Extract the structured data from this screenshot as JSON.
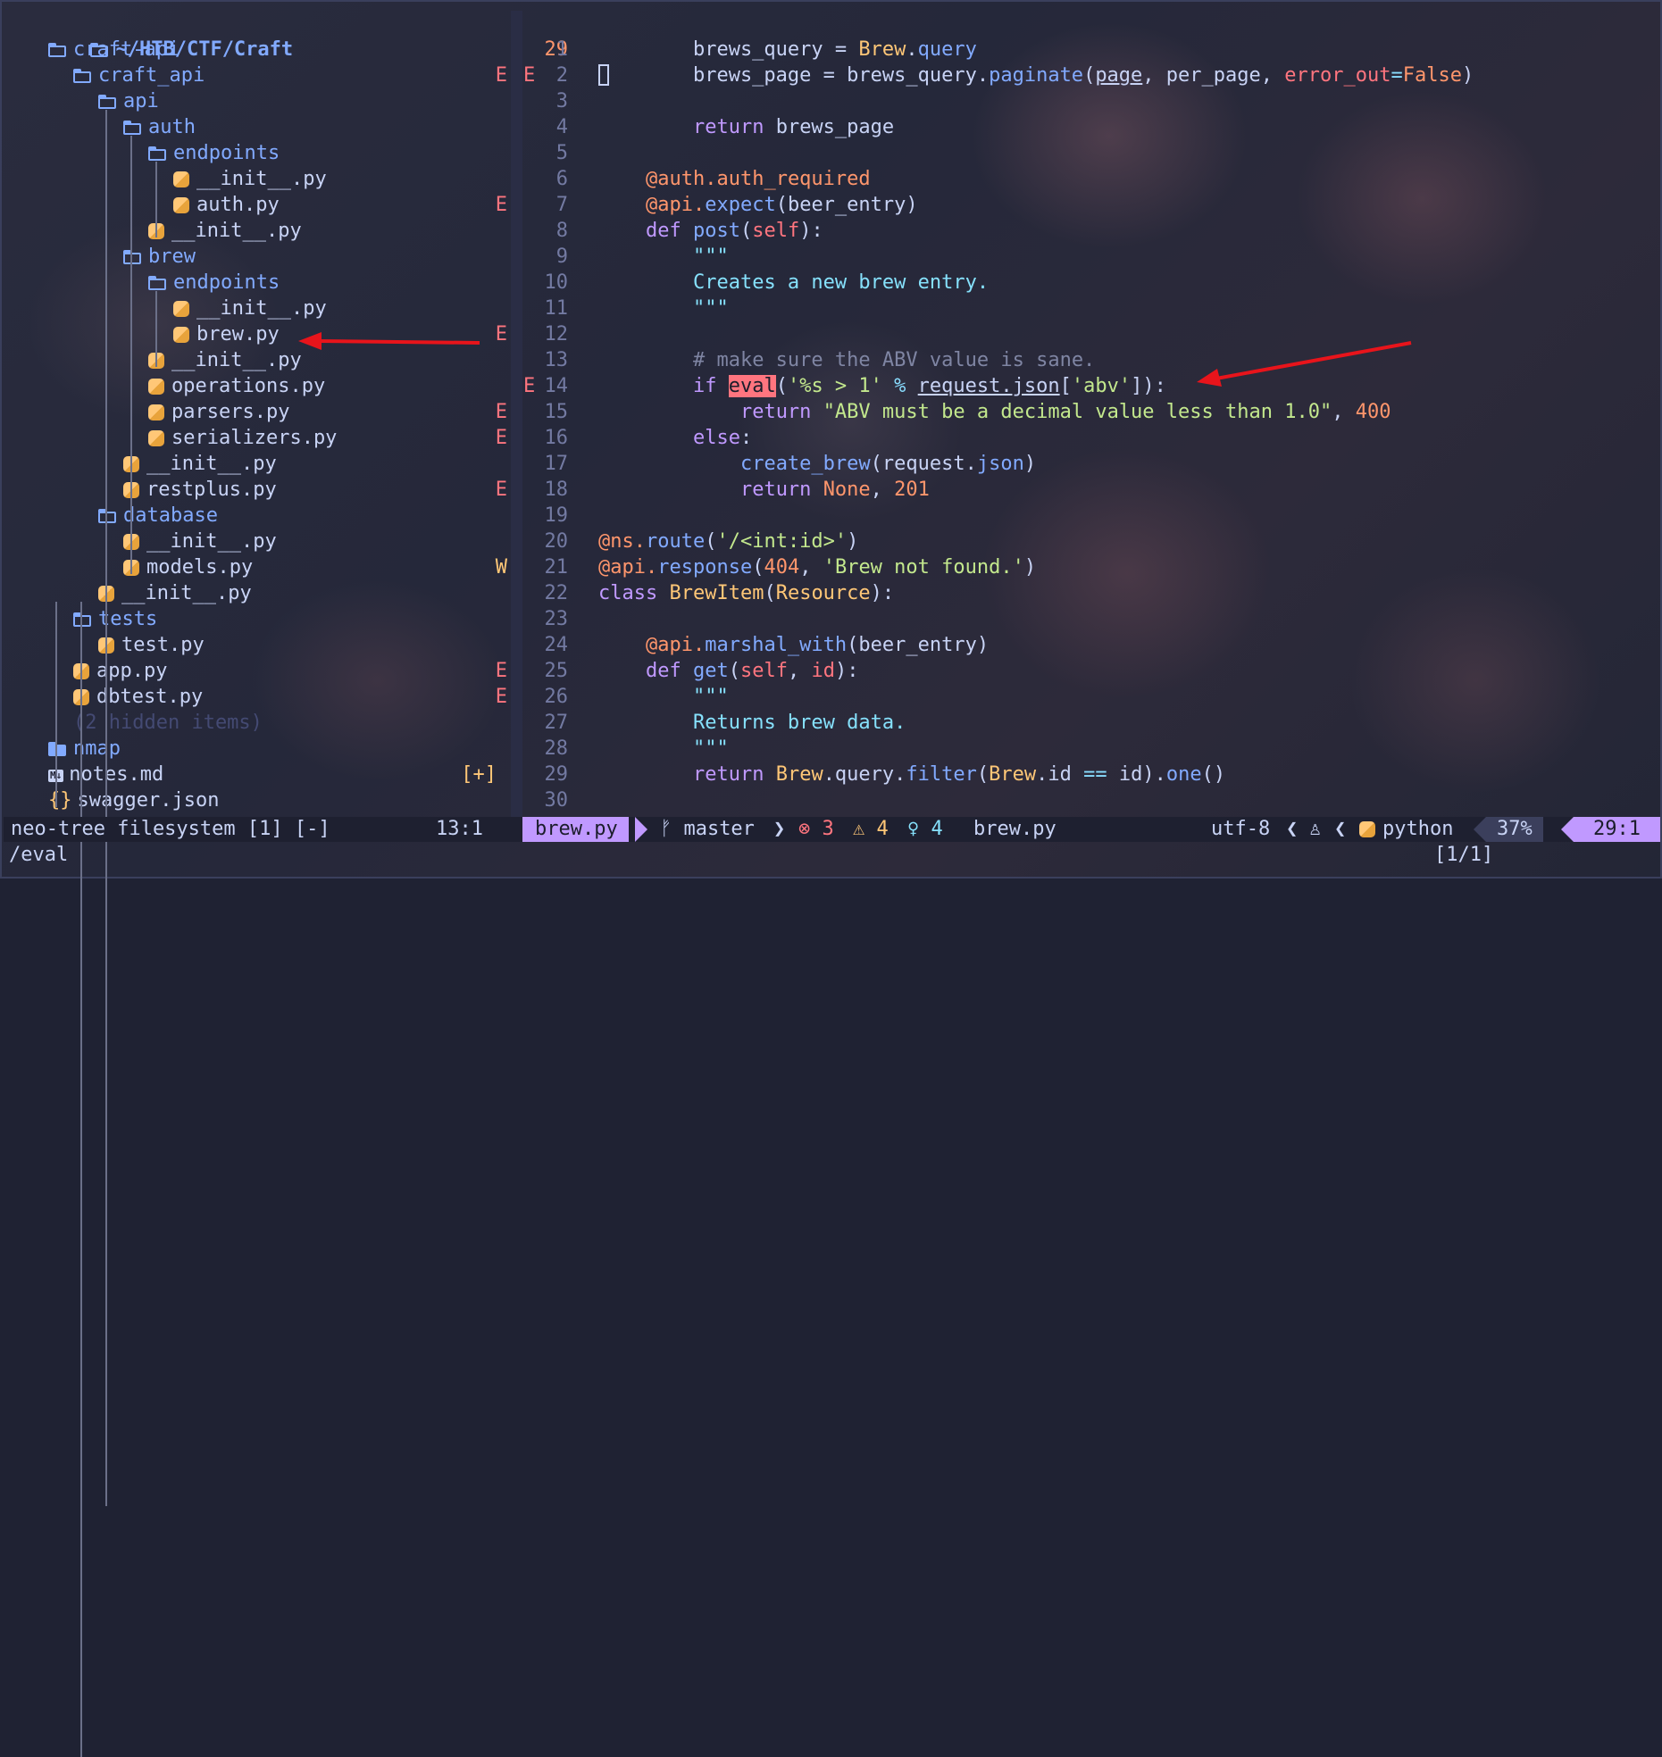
{
  "tree": {
    "root": "~/HTB/CTF/Craft",
    "items": [
      {
        "label": "craft-api",
        "kind": "dir-open",
        "indent": 1,
        "diag": ""
      },
      {
        "label": "craft_api",
        "kind": "dir-open",
        "indent": 2,
        "diag": "E"
      },
      {
        "label": "api",
        "kind": "dir-open",
        "indent": 3,
        "diag": ""
      },
      {
        "label": "auth",
        "kind": "dir-open",
        "indent": 4,
        "diag": ""
      },
      {
        "label": "endpoints",
        "kind": "dir-open",
        "indent": 5,
        "diag": ""
      },
      {
        "label": "__init__.py",
        "kind": "py",
        "indent": 6,
        "diag": ""
      },
      {
        "label": "auth.py",
        "kind": "py",
        "indent": 6,
        "diag": "E"
      },
      {
        "label": "__init__.py",
        "kind": "py",
        "indent": 5,
        "diag": ""
      },
      {
        "label": "brew",
        "kind": "dir-open",
        "indent": 4,
        "diag": ""
      },
      {
        "label": "endpoints",
        "kind": "dir-open",
        "indent": 5,
        "diag": ""
      },
      {
        "label": "__init__.py",
        "kind": "py",
        "indent": 6,
        "diag": ""
      },
      {
        "label": "brew.py",
        "kind": "py",
        "indent": 6,
        "diag": "E"
      },
      {
        "label": "__init__.py",
        "kind": "py",
        "indent": 5,
        "diag": ""
      },
      {
        "label": "operations.py",
        "kind": "py",
        "indent": 5,
        "diag": ""
      },
      {
        "label": "parsers.py",
        "kind": "py",
        "indent": 5,
        "diag": "E"
      },
      {
        "label": "serializers.py",
        "kind": "py",
        "indent": 5,
        "diag": "E"
      },
      {
        "label": "__init__.py",
        "kind": "py",
        "indent": 4,
        "diag": ""
      },
      {
        "label": "restplus.py",
        "kind": "py",
        "indent": 4,
        "diag": "E"
      },
      {
        "label": "database",
        "kind": "dir-open",
        "indent": 3,
        "diag": ""
      },
      {
        "label": "__init__.py",
        "kind": "py",
        "indent": 4,
        "diag": ""
      },
      {
        "label": "models.py",
        "kind": "py",
        "indent": 4,
        "diag": "W"
      },
      {
        "label": "__init__.py",
        "kind": "py",
        "indent": 3,
        "diag": ""
      },
      {
        "label": "tests",
        "kind": "dir-open",
        "indent": 2,
        "diag": ""
      },
      {
        "label": "test.py",
        "kind": "py",
        "indent": 3,
        "diag": ""
      },
      {
        "label": "app.py",
        "kind": "py",
        "indent": 2,
        "diag": "E"
      },
      {
        "label": "dbtest.py",
        "kind": "py",
        "indent": 2,
        "diag": "E"
      },
      {
        "label": "(2 hidden items)",
        "kind": "hidden",
        "indent": 2,
        "diag": ""
      },
      {
        "label": "nmap",
        "kind": "dir",
        "indent": 1,
        "diag": ""
      },
      {
        "label": "notes.md",
        "kind": "md",
        "indent": 1,
        "diag": "[+]"
      },
      {
        "label": "swagger.json",
        "kind": "json",
        "indent": 1,
        "diag": ""
      }
    ]
  },
  "editor": {
    "cursor_line_number": "29",
    "line_numbers": [
      "1",
      "2",
      "3",
      "4",
      "5",
      "6",
      "7",
      "8",
      "9",
      "10",
      "11",
      "12",
      "13",
      "14",
      "15",
      "16",
      "17",
      "18",
      "19",
      "20",
      "21",
      "22",
      "23",
      "24",
      "25",
      "26",
      "27",
      "28",
      "29",
      "30"
    ],
    "gutter_marks": {
      "2": "E",
      "14": "E"
    },
    "search_match": "eval",
    "string_abv_error": "\"ABV must be a decimal value less than 1.0\""
  },
  "statusbar": {
    "left": "neo-tree filesystem [1] [-]",
    "left_position": "13:1",
    "file": "brew.py",
    "branch": "master",
    "errors": "3",
    "warnings": "4",
    "hints": "4",
    "file2": "brew.py",
    "encoding": "utf-8",
    "filetype": "python",
    "percent": "37%",
    "position": "29:1"
  },
  "cmdline": {
    "text": "/eval",
    "match_count": "[1/1]"
  },
  "colors": {
    "accent": "#c099ff",
    "error": "#ff757f",
    "warning": "#ffc777",
    "annotation_arrow": "#e8141b"
  }
}
